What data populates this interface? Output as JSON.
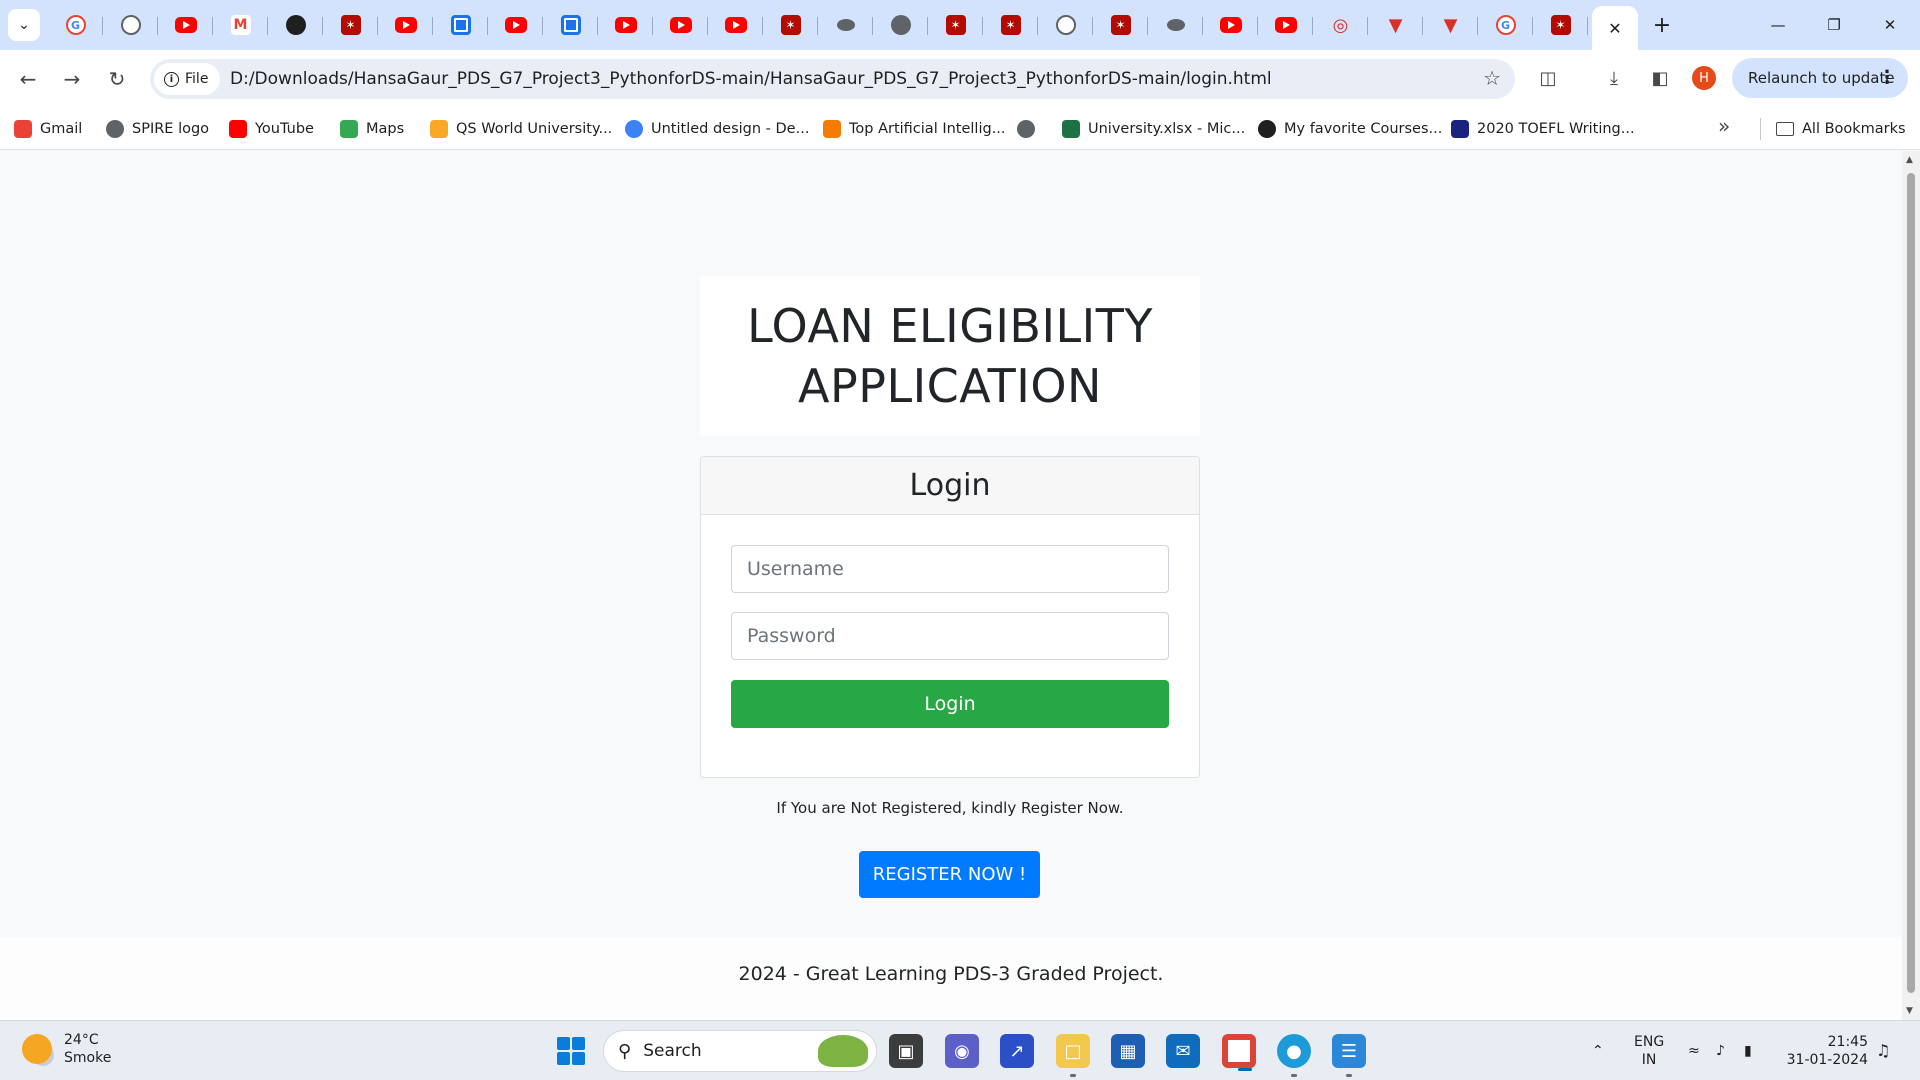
{
  "browser": {
    "tabs": [
      {
        "icon": "google-icon"
      },
      {
        "icon": "chatgpt-icon"
      },
      {
        "icon": "youtube-icon"
      },
      {
        "icon": "gmail-icon"
      },
      {
        "icon": "github-icon"
      },
      {
        "icon": "pdf-icon"
      },
      {
        "icon": "youtube-icon"
      },
      {
        "icon": "doc-icon"
      },
      {
        "icon": "youtube-icon"
      },
      {
        "icon": "doc-icon"
      },
      {
        "icon": "youtube-icon"
      },
      {
        "icon": "youtube-icon"
      },
      {
        "icon": "youtube-icon"
      },
      {
        "icon": "pdf-icon"
      },
      {
        "icon": "video-icon"
      },
      {
        "icon": "globe-icon"
      },
      {
        "icon": "pdf-icon"
      },
      {
        "icon": "pdf-icon"
      },
      {
        "icon": "ai-icon"
      },
      {
        "icon": "pdf-icon"
      },
      {
        "icon": "video-icon"
      },
      {
        "icon": "youtube-icon"
      },
      {
        "icon": "youtube-icon"
      },
      {
        "icon": "wifi-icon"
      },
      {
        "icon": "triangle-icon"
      },
      {
        "icon": "triangle-icon"
      },
      {
        "icon": "google-icon"
      },
      {
        "icon": "pdf-icon"
      }
    ],
    "site_chip": "File",
    "url": "D:/Downloads/HansaGaur_PDS_G7_Project3_PythonforDS-main/HansaGaur_PDS_G7_Project3_PythonforDS-main/login.html",
    "profile_initial": "H",
    "relaunch_label": "Relaunch to update",
    "bookmarks": [
      {
        "label": "Gmail",
        "icon": "gmail-icon",
        "color": "#ea4335"
      },
      {
        "label": "SPIRE logo",
        "icon": "globe-icon",
        "color": "#5f6368"
      },
      {
        "label": "YouTube",
        "icon": "youtube-icon",
        "color": "#ff0000"
      },
      {
        "label": "Maps",
        "icon": "maps-icon",
        "color": "#34a853"
      },
      {
        "label": "QS World University...",
        "icon": "qs-icon",
        "color": "#f9a825"
      },
      {
        "label": "Untitled design - De...",
        "icon": "canva-icon",
        "color": "#3b82f6"
      },
      {
        "label": "Top Artificial Intellig...",
        "icon": "ai-article-icon",
        "color": "#f57c00"
      },
      {
        "label": "",
        "icon": "globe-icon",
        "color": "#5f6368"
      },
      {
        "label": "University.xlsx - Mic...",
        "icon": "excel-icon",
        "color": "#1e7145"
      },
      {
        "label": "My favorite Courses...",
        "icon": "medium-icon",
        "color": "#1f1f1f"
      },
      {
        "label": "2020 TOEFL Writing...",
        "icon": "toefl-icon",
        "color": "#1a237e"
      }
    ],
    "all_bookmarks_label": "All Bookmarks"
  },
  "page": {
    "title": "LOAN ELIGIBILITY APPLICATION",
    "login": {
      "header": "Login",
      "username_placeholder": "Username",
      "password_placeholder": "Password",
      "button_label": "Login",
      "button_color": "#28a745"
    },
    "register_prompt": "If You are Not Registered, kindly Register Now.",
    "register_button_label": "REGISTER NOW !",
    "register_button_color": "#007bff",
    "footer": "2024 - Great Learning PDS-3 Graded Project."
  },
  "taskbar": {
    "weather_temp": "24°C",
    "weather_desc": "Smoke",
    "search_label": "Search",
    "lang_top": "ENG",
    "lang_bottom": "IN",
    "time": "21:45",
    "date": "31-01-2024"
  }
}
